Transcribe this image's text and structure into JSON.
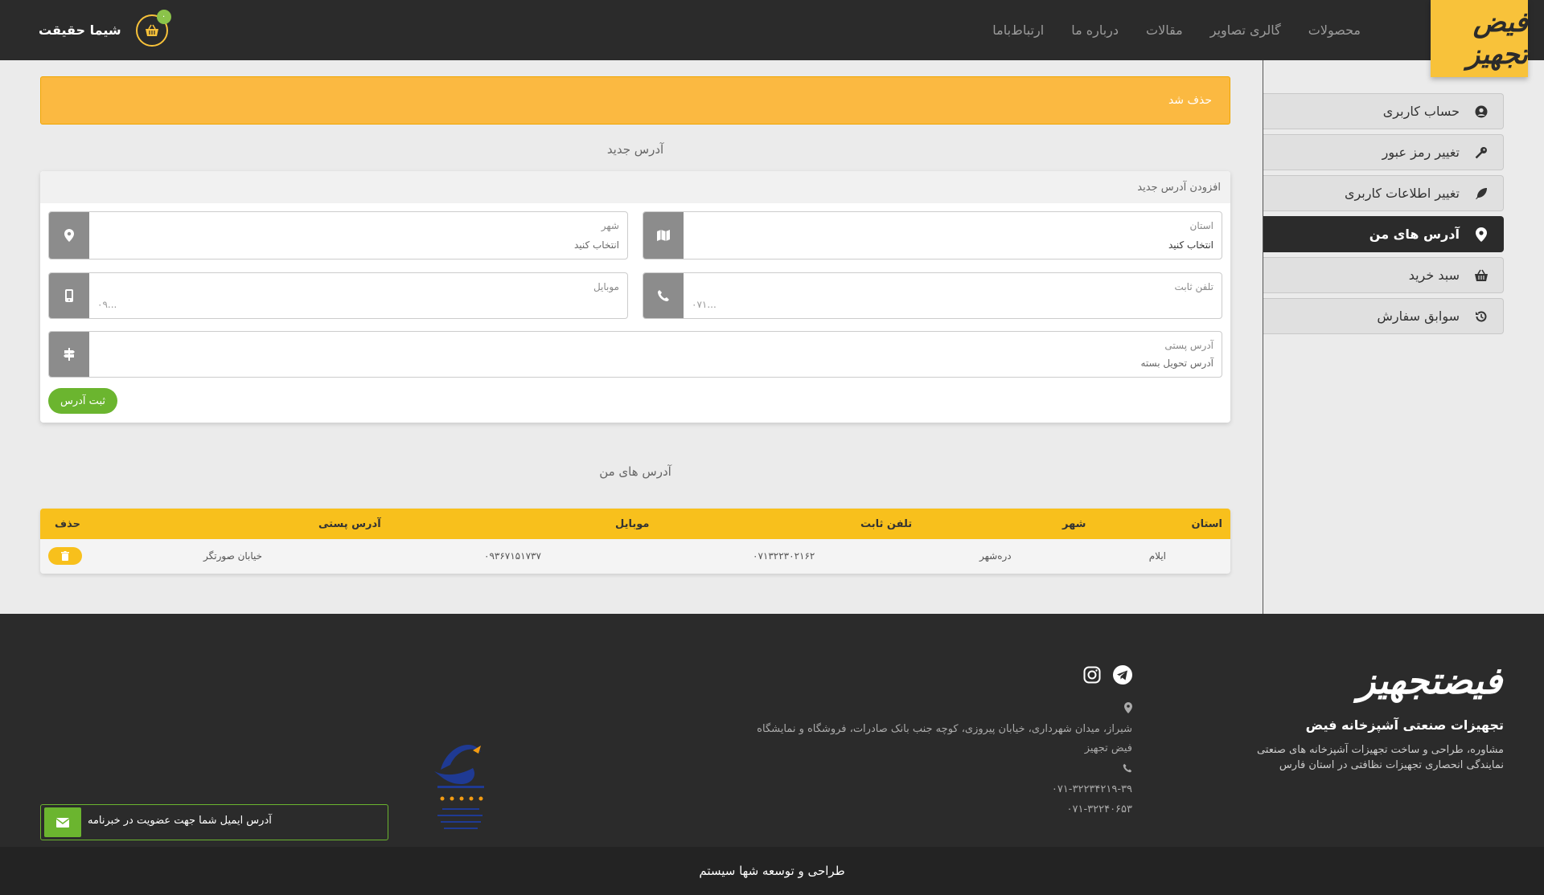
{
  "header": {
    "logo_text": "فیض تجهیز",
    "nav": [
      "محصولات",
      "گالری تصاویر",
      "مقالات",
      "درباره ما",
      "ارتباط‌باما"
    ],
    "user_name": "شیما حقیقت",
    "cart_count": "۰"
  },
  "sidebar": {
    "items": [
      {
        "label": "حساب کاربری",
        "icon": "user-circle-icon",
        "active": false
      },
      {
        "label": "تغییر رمز عبور",
        "icon": "key-icon",
        "active": false
      },
      {
        "label": "تغییر اطلاعات کاربری",
        "icon": "feather-icon",
        "active": false
      },
      {
        "label": "آدرس های من",
        "icon": "map-marker-icon",
        "active": true
      },
      {
        "label": "سبد خرید",
        "icon": "basket-icon",
        "active": false
      },
      {
        "label": "سوابق سفارش",
        "icon": "history-icon",
        "active": false
      }
    ]
  },
  "alert": {
    "text": "حذف شد"
  },
  "new_address": {
    "section_title": "آدرس جدید",
    "card_title": "افزودن آدرس جدید",
    "province": {
      "label": "استان",
      "value": "انتخاب کنید"
    },
    "city": {
      "label": "شهر",
      "value": "انتخاب کنید"
    },
    "phone": {
      "label": "تلفن ثابت",
      "placeholder": "۰۷۱..."
    },
    "mobile": {
      "label": "موبایل",
      "placeholder": "۰۹..."
    },
    "postal_address": {
      "label": "آدرس پستی",
      "placeholder": "آدرس تحویل بسته"
    },
    "submit_label": "ثبت آدرس"
  },
  "my_addresses": {
    "section_title": "آدرس های من",
    "columns": [
      "استان",
      "شهر",
      "تلفن ثابت",
      "موبایل",
      "آدرس پستی",
      "حذف"
    ],
    "rows": [
      {
        "province": "ایلام",
        "city": "دره‌شهر",
        "phone": "۰۷۱۳۲۲۳۰۲۱۶۲",
        "mobile": "۰۹۳۶۷۱۵۱۷۳۷",
        "address": "خیابان صورتگر"
      }
    ]
  },
  "footer": {
    "logo_main": "فیض",
    "logo_sub": "تجهیز",
    "title": "تجهیزات صنعتی آشپزخانه فیض",
    "desc_line1": "مشاوره، طراحی و ساخت تجهیزات آشپزخانه های صنعتی",
    "desc_line2": "نمایندگی انحصاری تجهیزات نظافتی در استان فارس",
    "address_line1": "شیراز، میدان شهرداری، خیابان پیروزی، کوچه جنب بانک صادرات، فروشگاه و نمایشگاه",
    "address_line2": "فیض تجهیز",
    "phone1": "۰۷۱-۳۲۲۳۴۲۱۹-۳۹",
    "phone2": "۰۷۱-۳۲۲۴۰۶۵۳",
    "newsletter_placeholder": "آدرس ایمیل شما جهت عضویت در خبرنامه",
    "credit": "طراحی و توسعه شها سیستم"
  },
  "colors": {
    "accent": "#f8c23a",
    "dark": "#2b2b2b",
    "green": "#6bb52f",
    "alert": "#fbb941"
  }
}
